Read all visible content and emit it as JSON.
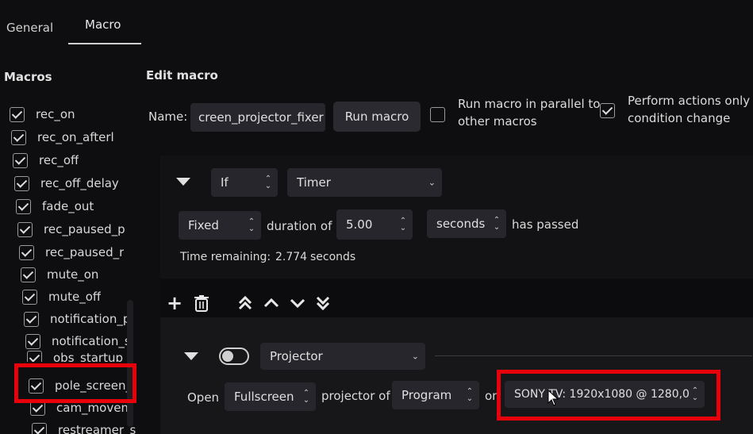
{
  "tabs": [
    {
      "label": "General"
    },
    {
      "label": "Macro"
    }
  ],
  "sidebar": {
    "title": "Macros",
    "items": [
      {
        "label": "rec_on"
      },
      {
        "label": "rec_on_afterl"
      },
      {
        "label": "rec_off"
      },
      {
        "label": "rec_off_delay"
      },
      {
        "label": "fade_out"
      },
      {
        "label": "rec_paused_p"
      },
      {
        "label": "rec_paused_r"
      },
      {
        "label": "mute_on"
      },
      {
        "label": "mute_off"
      },
      {
        "label": "notification_p"
      },
      {
        "label": "notification_s"
      },
      {
        "label": "obs_startup"
      },
      {
        "label": "pole_screen_"
      },
      {
        "label": "cam_movem"
      },
      {
        "label": "restreamer_s"
      }
    ]
  },
  "edit": {
    "title": "Edit macro",
    "name_label": "Name:",
    "name_value": "creen_projector_fixer",
    "run_button": "Run macro",
    "parallel_line1": "Run macro in parallel to",
    "parallel_line2": "other macros",
    "perform_line1": "Perform actions only",
    "perform_line2": "condition change"
  },
  "condition": {
    "logic": "If",
    "type": "Timer",
    "mode": "Fixed",
    "duration_of": "duration of",
    "duration_value": "5.00",
    "unit": "seconds",
    "has_passed": "has passed",
    "remaining_label": "Time remaining:",
    "remaining_value": "2.774",
    "remaining_unit": "seconds"
  },
  "toolbar": {
    "add": "+",
    "top": "⤒",
    "up": "︿",
    "down": "﹀",
    "bottom": "⤓"
  },
  "action": {
    "type": "Projector",
    "open_label": "Open",
    "window_mode": "Fullscreen",
    "projector_of": "projector of",
    "source": "Program",
    "on_label": "on",
    "monitor": "SONY TV: 1920x1080 @ 1280,0"
  },
  "colors": {
    "background": "#0e0e10",
    "highlight_red": "#e8000a"
  }
}
